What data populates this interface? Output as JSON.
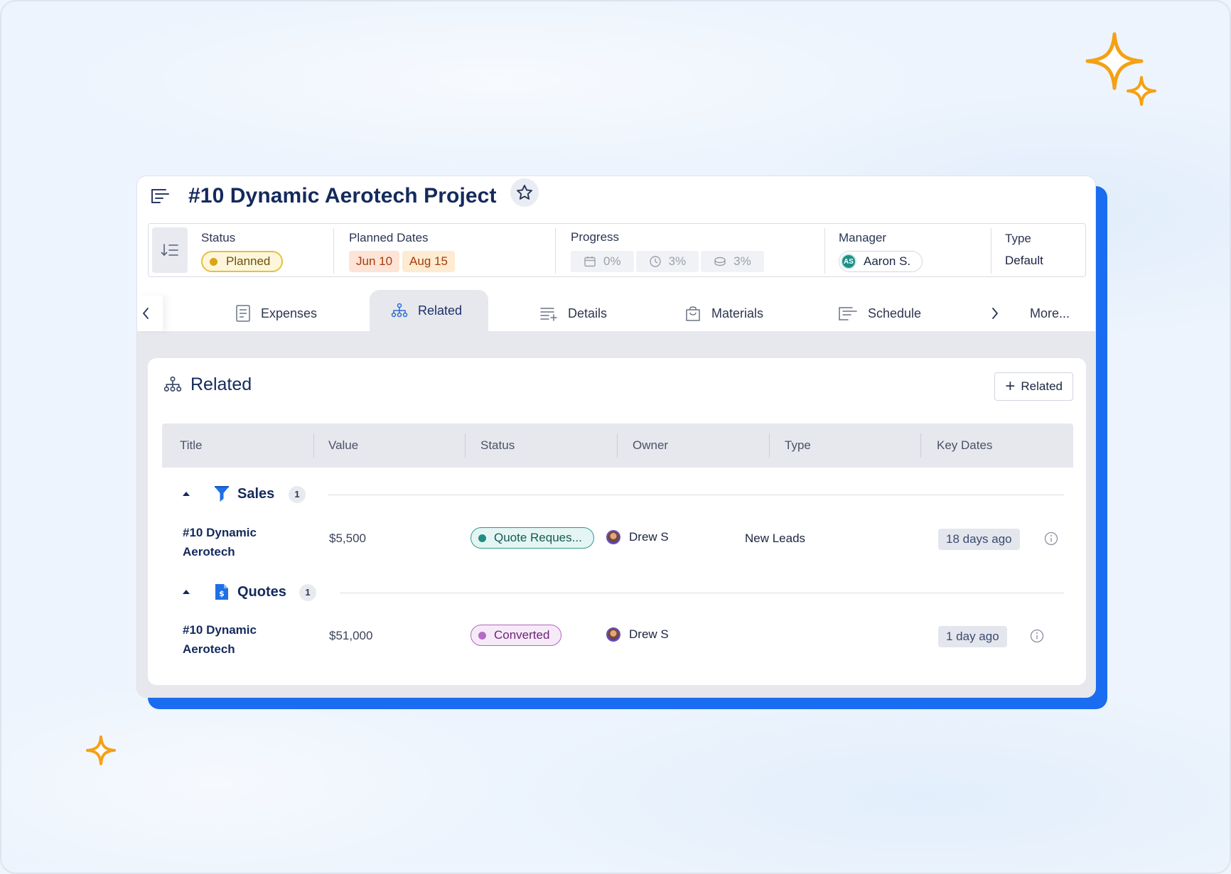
{
  "project": {
    "title": "#10 Dynamic Aerotech Project"
  },
  "summary": {
    "status": {
      "label": "Status",
      "value": "Planned"
    },
    "planned_dates": {
      "label": "Planned Dates",
      "start": "Jun 10",
      "end": "Aug 15"
    },
    "progress": {
      "label": "Progress",
      "items": [
        {
          "icon": "calendar-icon",
          "value": "0%"
        },
        {
          "icon": "clock-icon",
          "value": "3%"
        },
        {
          "icon": "coins-icon",
          "value": "3%"
        }
      ]
    },
    "manager": {
      "label": "Manager",
      "initials": "AS",
      "name": "Aaron S."
    },
    "type": {
      "label": "Type",
      "value": "Default"
    }
  },
  "tabs": [
    {
      "label": "Expenses",
      "icon": "receipt-icon",
      "active": false
    },
    {
      "label": "Related",
      "icon": "hierarchy-icon",
      "active": true
    },
    {
      "label": "Details",
      "icon": "list-add-icon",
      "active": false
    },
    {
      "label": "Materials",
      "icon": "bag-icon",
      "active": false
    },
    {
      "label": "Schedule",
      "icon": "gantt-icon",
      "active": false
    }
  ],
  "more_label": "More...",
  "panel": {
    "title": "Related",
    "add_button": "Related",
    "columns": [
      "Title",
      "Value",
      "Status",
      "Owner",
      "Type",
      "Key Dates"
    ],
    "groups": [
      {
        "name": "Sales",
        "count": "1",
        "icon": "funnel-icon",
        "rows": [
          {
            "title_line1": "#10 Dynamic",
            "title_line2": "Aerotech",
            "value": "$5,500",
            "status": "Quote Reques...",
            "owner": "Drew S",
            "type": "New Leads",
            "key_date": "18 days ago"
          }
        ]
      },
      {
        "name": "Quotes",
        "count": "1",
        "icon": "quote-doc-icon",
        "rows": [
          {
            "title_line1": "#10 Dynamic",
            "title_line2": "Aerotech",
            "value": "$51,000",
            "status": "Converted",
            "owner": "Drew S",
            "type": "",
            "key_date": "1 day ago"
          }
        ]
      }
    ]
  },
  "colors": {
    "accent_blue": "#1a6cf0",
    "sparkle": "#f5a015",
    "planned_dot": "#d9a514",
    "quote_status": "#1e8e82",
    "converted_status": "#b56ac4"
  }
}
